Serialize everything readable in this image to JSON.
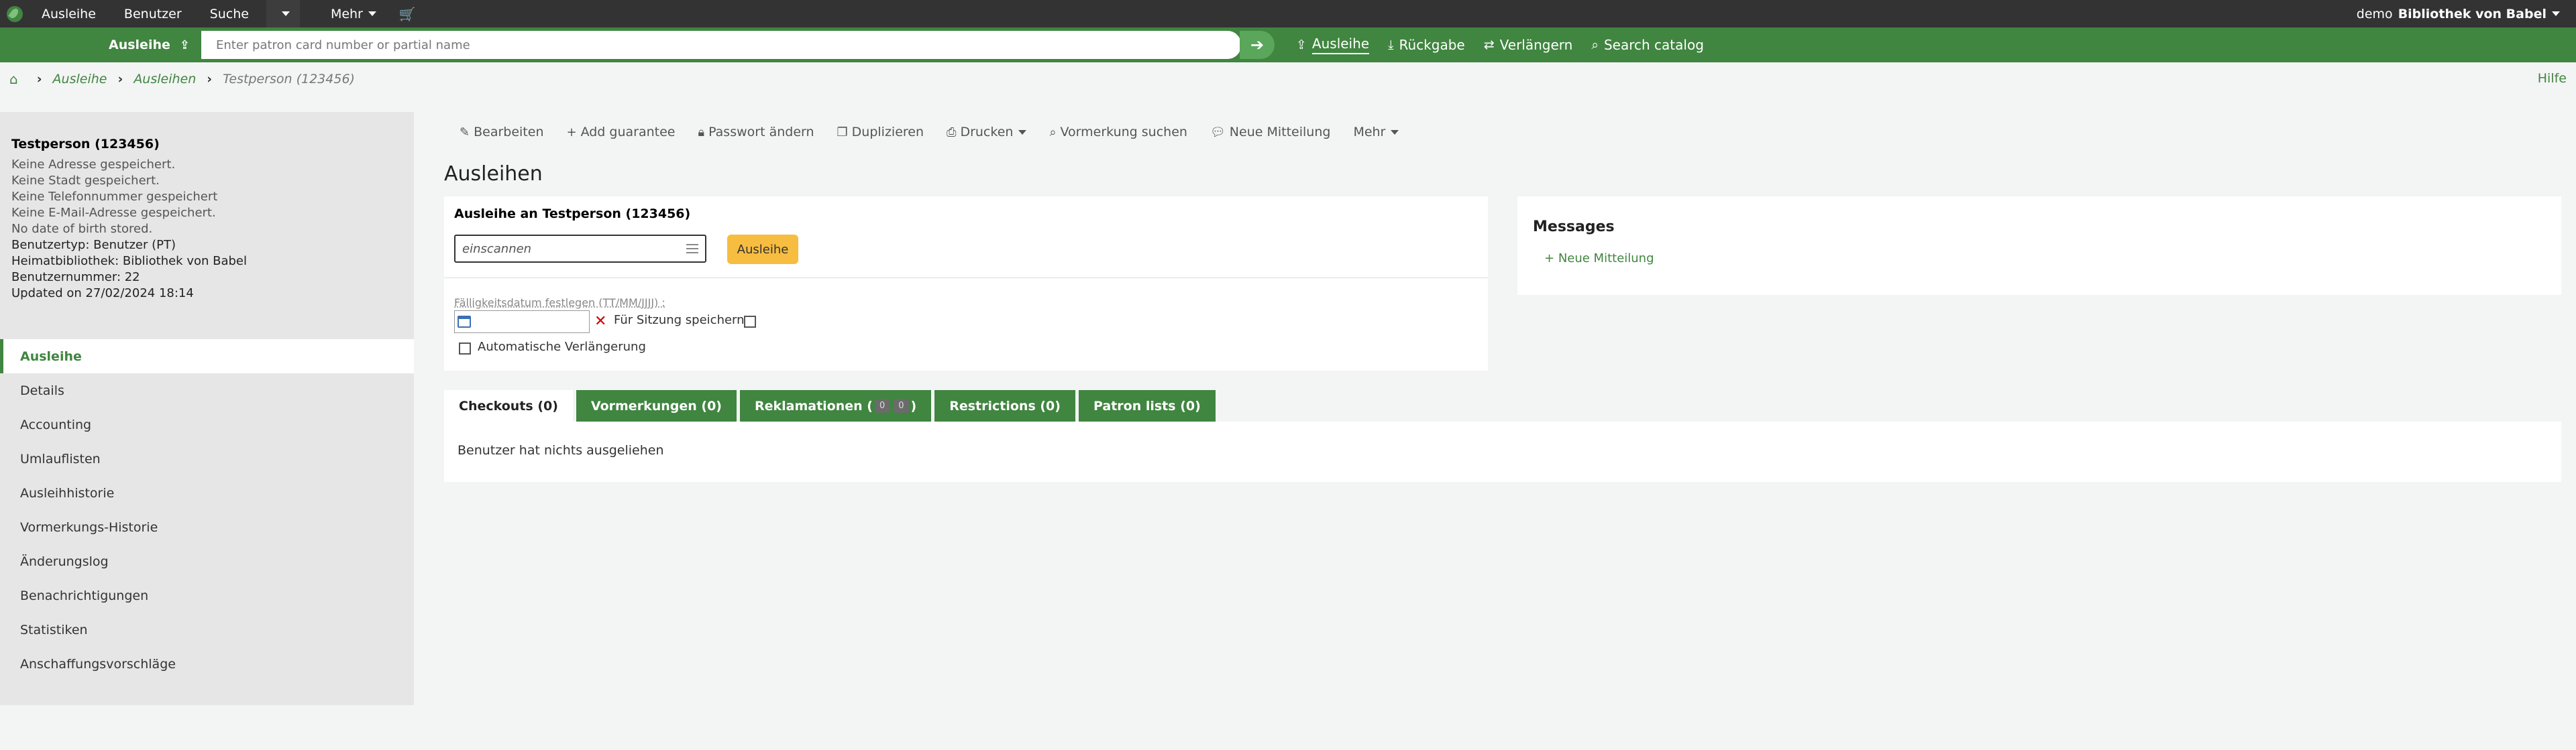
{
  "topbar": {
    "nav": [
      "Ausleihe",
      "Benutzer",
      "Suche"
    ],
    "more_label": "Mehr",
    "user_prefix": "demo",
    "library": "Bibliothek von Babel"
  },
  "greenbar": {
    "mode_label": "Ausleihe",
    "search_placeholder": "Enter patron card number or partial name",
    "links": [
      "Ausleihe",
      "Rückgabe",
      "Verlängern",
      "Search catalog"
    ]
  },
  "breadcrumb": {
    "items": [
      "Ausleihe",
      "Ausleihen",
      "Testperson (123456)"
    ],
    "help": "Hilfe"
  },
  "patron": {
    "name": "Testperson (123456)",
    "lines": [
      "Keine Adresse gespeichert.",
      "Keine Stadt gespeichert.",
      "Keine Telefonnummer gespeichert",
      "Keine E-Mail-Adresse gespeichert.",
      "No date of birth stored."
    ],
    "details": [
      "Benutzertyp: Benutzer (PT)",
      "Heimatbibliothek: Bibliothek von Babel",
      "Benutzernummer: 22",
      "Updated on 27/02/2024 18:14"
    ]
  },
  "sidebar": {
    "items": [
      "Ausleihe",
      "Details",
      "Accounting",
      "Umlauflisten",
      "Ausleihhistorie",
      "Vormerkungs-Historie",
      "Änderungslog",
      "Benachrichtigungen",
      "Statistiken",
      "Anschaffungsvorschläge"
    ]
  },
  "toolbar": {
    "items": [
      "Bearbeiten",
      "Add guarantee",
      "Passwort ändern",
      "Duplizieren",
      "Drucken",
      "Vormerkung suchen",
      "Neue Mitteilung",
      "Mehr"
    ]
  },
  "main": {
    "title": "Ausleihen",
    "checkout_title": "Ausleihe an Testperson (123456)",
    "barcode_placeholder": "einscannen",
    "checkout_button": "Ausleihe",
    "due_label": "Fälligkeitsdatum festlegen (TT/MM/JJJJ) :",
    "session_label": "Für Sitzung speichern:",
    "auto_renew_label": "Automatische Verlängerung"
  },
  "messages": {
    "title": "Messages",
    "new_message": "Neue Mitteilung"
  },
  "tabs": {
    "checkouts": "Checkouts (0)",
    "holds": "Vormerkungen (0)",
    "claims_label": "Reklamationen (",
    "claims_count_1": "0",
    "claims_count_2": "0",
    "claims_close": ")",
    "restrictions": "Restrictions (0)",
    "patron_lists": "Patron lists (0)",
    "empty_message": "Benutzer hat nichts ausgeliehen"
  }
}
